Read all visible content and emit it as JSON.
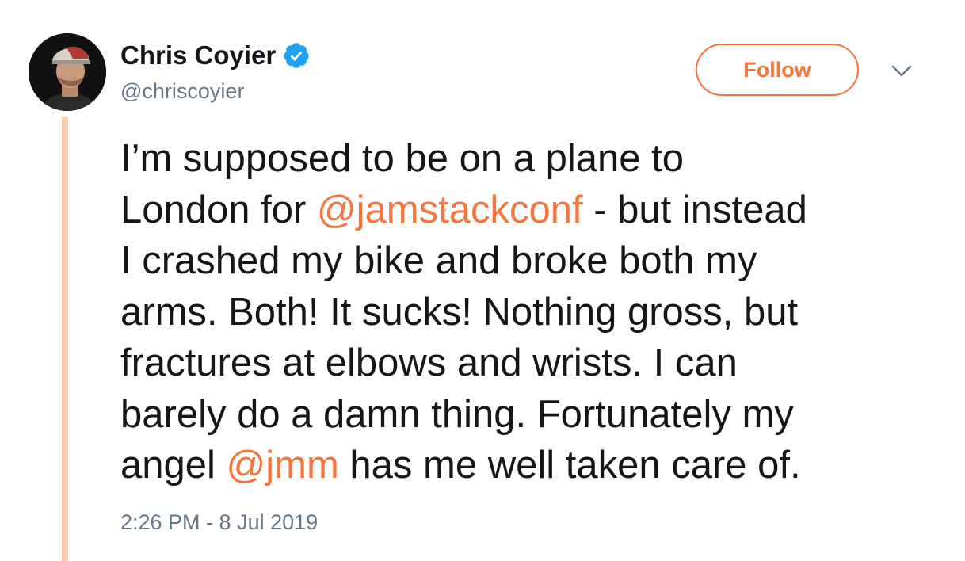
{
  "author": {
    "display_name": "Chris Coyier",
    "handle": "@chriscoyier",
    "verified": true,
    "avatar_icon": "avatar-photo"
  },
  "actions": {
    "follow_label": "Follow",
    "menu_icon": "chevron-down-icon"
  },
  "tweet": {
    "line1": "I’m supposed to be on a plane to",
    "line2_before": "London for ",
    "mention1": "@jamstackconf",
    "line2_after": " - but instead",
    "line3": "I crashed my bike and broke both my",
    "line4": "arms. Both! It sucks! Nothing gross, but",
    "line5": "fractures at elbows and wrists. I can",
    "line6": "barely do a damn thing. Fortunately my",
    "line7_before": "angel ",
    "mention2": "@jmm",
    "line7_after": " has me well taken care of."
  },
  "meta": {
    "timestamp": "2:26 PM - 8 Jul 2019"
  },
  "colors": {
    "accent": "#f4753d",
    "thread_line": "#fccbb2",
    "verified_blue": "#1da1f2",
    "secondary_text": "#657786",
    "text": "#14171a"
  }
}
